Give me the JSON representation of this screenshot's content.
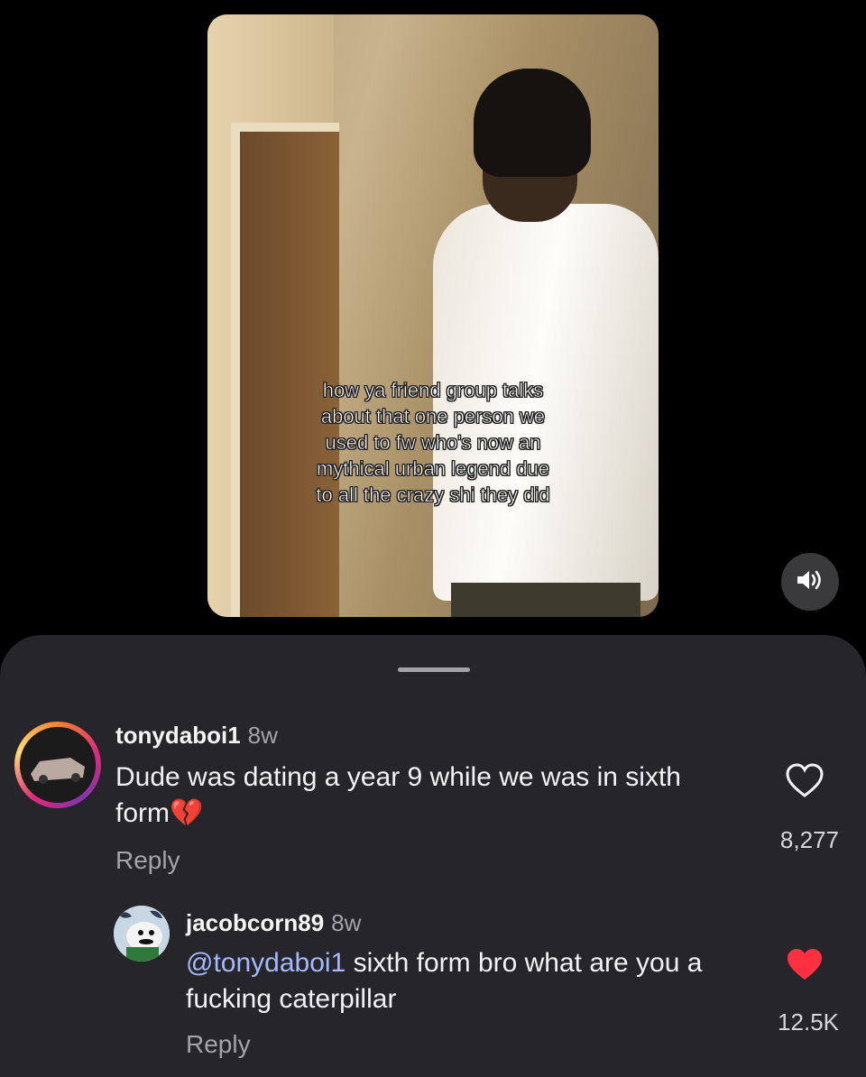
{
  "video": {
    "caption_lines": [
      "how ya friend group talks",
      "about that one person we",
      "used to fw who's now an",
      "mythical urban legend due",
      "to all the crazy shi they did"
    ]
  },
  "controls": {
    "sound_icon": "speaker-icon"
  },
  "comments": [
    {
      "username": "tonydaboi1",
      "time": "8w",
      "text": "Dude was dating a year 9 while we was in sixth form",
      "emoji": "💔",
      "reply_label": "Reply",
      "likes": "8,277",
      "liked": false
    },
    {
      "username": "jacobcorn89",
      "time": "8w",
      "mention": "@tonydaboi1",
      "text": " sixth form bro what are you a fucking caterpillar",
      "reply_label": "Reply",
      "likes": "12.5K",
      "liked": true
    }
  ],
  "colors": {
    "heart_liked": "#ff3040",
    "mention": "#a4b9ff",
    "sheet_bg": "#26262a"
  }
}
